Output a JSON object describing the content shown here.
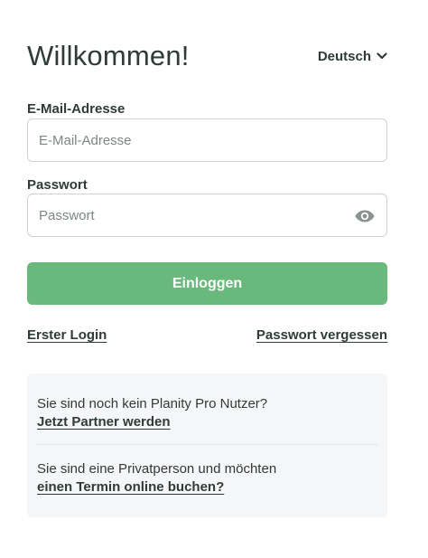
{
  "header": {
    "title": "Willkommen!",
    "language": "Deutsch",
    "language_icon": "chevron-down-icon"
  },
  "form": {
    "email_label": "E-Mail-Adresse",
    "email_placeholder": "E-Mail-Adresse",
    "password_label": "Passwort",
    "password_placeholder": "Passwort",
    "password_toggle_icon": "eye-icon",
    "login_button": "Einloggen"
  },
  "links": {
    "first_login": "Erster Login",
    "forgot_password": "Passwort vergessen"
  },
  "info": {
    "partner_text": "Sie sind noch kein Planity Pro Nutzer?",
    "partner_link": "Jetzt Partner werden",
    "private_text": "Sie sind eine Privatperson und möchten",
    "private_link": "einen Termin online buchen?"
  },
  "colors": {
    "primary_button": "#69b87c",
    "text": "#2f3b37",
    "info_background": "#f5f6f7"
  }
}
